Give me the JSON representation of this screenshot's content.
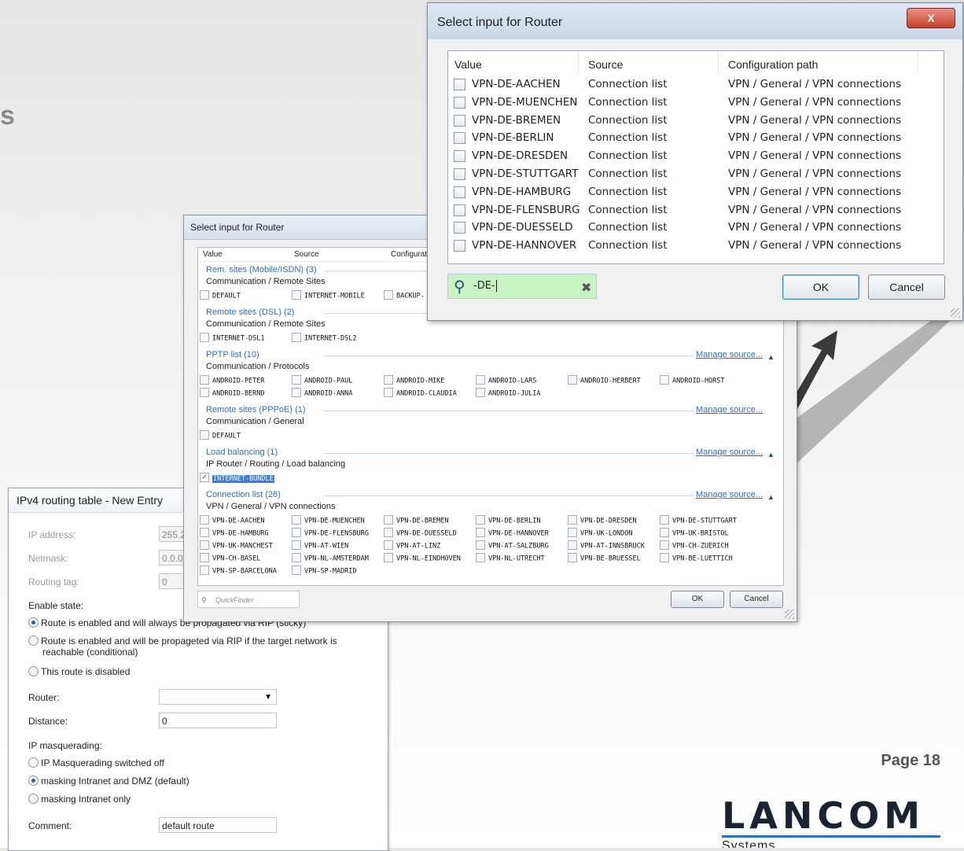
{
  "page": {
    "heading_fragment": "s",
    "page_number": "Page 18",
    "logo": {
      "word": "LANCOM",
      "sub": "Systems"
    }
  },
  "routing_dialog": {
    "title": "IPv4 routing table - New Entry",
    "ip_address_label": "IP address:",
    "ip_address_value": "255.2",
    "netmask_label": "Netmask:",
    "netmask_value": "0.0.0.",
    "routing_tag_label": "Routing tag:",
    "routing_tag_value": "0",
    "enable_state_label": "Enable state:",
    "enable_opt1": "Route is enabled and will always be propagated via RIP (sticky)",
    "enable_opt2a": "Route is enabled and will be propageted via RIP if the target network is",
    "enable_opt2b": "reachable (conditional)",
    "enable_opt3": "This route is disabled",
    "router_label": "Router:",
    "router_value": "",
    "distance_label": "Distance:",
    "distance_value": "0",
    "masq_label": "IP masquerading:",
    "masq_opt1": "IP Masquerading switched off",
    "masq_opt2": "masking Intranet and DMZ (default)",
    "masq_opt3": "masking Intranet only",
    "comment_label": "Comment:",
    "comment_value": "default route"
  },
  "mid_dialog": {
    "title": "Select input for Router",
    "headers": [
      "Value",
      "Source",
      "Configurat"
    ],
    "manage_label": "Manage source...",
    "groups": [
      {
        "title": "Rem. sites (Mobile/ISDN) (3)",
        "path": "Communication / Remote Sites",
        "items": [
          "DEFAULT",
          "INTERNET-MOBILE",
          "BACKUP-"
        ]
      },
      {
        "title": "Remote sites (DSL) (2)",
        "path": "Communication / Remote Sites",
        "items": [
          "INTERNET-DSL1",
          "INTERNET-DSL2"
        ]
      },
      {
        "title": "PPTP list (10)",
        "path": "Communication / Protocols",
        "items": [
          "ANDROID-PETER",
          "ANDROID-PAUL",
          "ANDROID-MIKE",
          "ANDROID-LARS",
          "ANDROID-HERBERT",
          "ANDROID-HORST",
          "ANDROID-BERND",
          "ANDROID-ANNA",
          "ANDROID-CLAUDIA",
          "ANDROID-JULIA"
        ]
      },
      {
        "title": "Remote sites (PPPoE) (1)",
        "path": "Communication / General",
        "items": [
          "DEFAULT"
        ]
      },
      {
        "title": "Load balancing (1)",
        "path": "IP Router / Routing / Load balancing",
        "items": [
          "INTERNET-BUNDLE"
        ]
      },
      {
        "title": "Connection list (26)",
        "path": "VPN / General / VPN connections",
        "items": [
          "VPN-DE-AACHEN",
          "VPN-DE-MUENCHEN",
          "VPN-DE-BREMEN",
          "VPN-DE-BERLIN",
          "VPN-DE-DRESDEN",
          "VPN-DE-STUTTGART",
          "VPN-DE-HAMBURG",
          "VPN-DE-FLENSBURG",
          "VPN-DE-DUESSELD",
          "VPN-DE-HANNOVER",
          "VPN-UK-LONDON",
          "VPN-UK-BRISTOL",
          "VPN-UK-MANCHEST",
          "VPN-AT-WIEN",
          "VPN-AT-LINZ",
          "VPN-AT-SALZBURG",
          "VPN-AT-INNSBRUCK",
          "VPN-CH-ZUERICH",
          "VPN-CH-BASEL",
          "VPN-NL-AMSTERDAM",
          "VPN-NL-EINDHOVEN",
          "VPN-NL-UTRECHT",
          "VPN-BE-BRUESSEL",
          "VPN-BE-LUETTICH",
          "VPN-SP-BARCELONA",
          "VPN-SP-MADRID"
        ]
      }
    ],
    "quickfinder_placeholder": "QuickFinder",
    "ok_label": "OK",
    "cancel_label": "Cancel"
  },
  "big_dialog": {
    "title": "Select input for Router",
    "close_label": "X",
    "columns": [
      "Value",
      "Source",
      "Configuration path"
    ],
    "rows": [
      [
        "VPN-DE-AACHEN",
        "Connection list",
        "VPN / General / VPN connections"
      ],
      [
        "VPN-DE-MUENCHEN",
        "Connection list",
        "VPN / General / VPN connections"
      ],
      [
        "VPN-DE-BREMEN",
        "Connection list",
        "VPN / General / VPN connections"
      ],
      [
        "VPN-DE-BERLIN",
        "Connection list",
        "VPN / General / VPN connections"
      ],
      [
        "VPN-DE-DRESDEN",
        "Connection list",
        "VPN / General / VPN connections"
      ],
      [
        "VPN-DE-STUTTGART",
        "Connection list",
        "VPN / General / VPN connections"
      ],
      [
        "VPN-DE-HAMBURG",
        "Connection list",
        "VPN / General / VPN connections"
      ],
      [
        "VPN-DE-FLENSBURG",
        "Connection list",
        "VPN / General / VPN connections"
      ],
      [
        "VPN-DE-DUESSELD",
        "Connection list",
        "VPN / General / VPN connections"
      ],
      [
        "VPN-DE-HANNOVER",
        "Connection list",
        "VPN / General / VPN connections"
      ]
    ],
    "search_value": "-DE-",
    "ok_label": "OK",
    "cancel_label": "Cancel"
  },
  "colors": {
    "search_bg": "#c8f3c2",
    "link": "#2f6db8",
    "logo_bar": "#2a6fc0"
  }
}
